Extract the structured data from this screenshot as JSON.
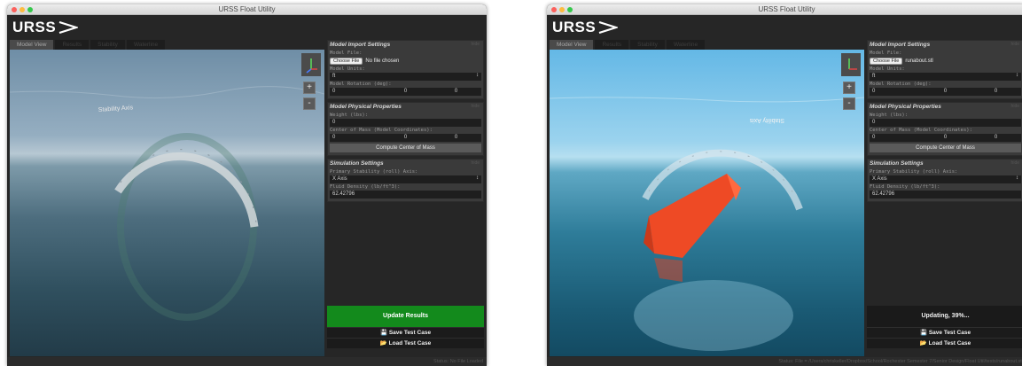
{
  "windows": [
    {
      "title": "URSS Float Utility",
      "logo": "URSS",
      "tabs": [
        "Model View",
        "Results",
        "Stability",
        "Waterline"
      ],
      "viewport": {
        "axis_label": "Stability Axis",
        "zoom_in": "+",
        "zoom_out": "-"
      },
      "import": {
        "title": "Model Import Settings",
        "hide": "hide",
        "file_label": "Model File:",
        "choose": "Choose File",
        "file_name": "No file chosen",
        "units_label": "Model Units:",
        "units": "ft",
        "rotation_label": "Model Rotation (deg):",
        "rotation": [
          "0",
          "0",
          "0"
        ]
      },
      "physical": {
        "title": "Model Physical Properties",
        "hide": "hide",
        "weight_label": "Weight (lbs):",
        "weight": "0",
        "com_label": "Center of Mass (Model Coordinates):",
        "com": [
          "0",
          "0",
          "0"
        ],
        "compute": "Compute Center of Mass"
      },
      "sim": {
        "title": "Simulation Settings",
        "hide": "hide",
        "axis_label": "Primary Stability (roll) Axis:",
        "axis": "X Axis",
        "density_label": "Fluid Density (lb/ft^3):",
        "density": "62.42796"
      },
      "update": "Update Results",
      "save": "Save Test Case",
      "load": "Load Test Case",
      "status": "Status: No File Loaded"
    },
    {
      "title": "URSS Float Utility",
      "logo": "URSS",
      "tabs": [
        "Model View",
        "Results",
        "Stability",
        "Waterline"
      ],
      "viewport": {
        "axis_label": "Stability Axis",
        "zoom_in": "+",
        "zoom_out": "-"
      },
      "import": {
        "title": "Model Import Settings",
        "hide": "hide",
        "file_label": "Model File:",
        "choose": "Choose File",
        "file_name": "runabout.stl",
        "units_label": "Model Units:",
        "units": "ft",
        "rotation_label": "Model Rotation (deg):",
        "rotation": [
          "0",
          "0",
          "0"
        ]
      },
      "physical": {
        "title": "Model Physical Properties",
        "hide": "hide",
        "weight_label": "Weight (lbs):",
        "weight": "0",
        "com_label": "Center of Mass (Model Coordinates):",
        "com": [
          "0",
          "0",
          "0"
        ],
        "compute": "Compute Center of Mass"
      },
      "sim": {
        "title": "Simulation Settings",
        "hide": "hide",
        "axis_label": "Primary Stability (roll) Axis:",
        "axis": "X Axis",
        "density_label": "Fluid Density (lb/ft^3):",
        "density": "62.42796"
      },
      "update": "Updating, 39%...",
      "save": "Save Test Case",
      "load": "Load Test Case",
      "status": "Status: File = /Users/chriskeller/Dropbox/School/Rochester Semester 7/Senior Design/Float Util/tests/runabout.stl"
    }
  ],
  "icons": [
    "save-icon",
    "load-icon",
    "axis-gizmo-icon",
    "logo-arrow-icon"
  ],
  "colors": {
    "update_green": "#138a1c",
    "hull_orange": "#ee4a25",
    "panel_bg": "#3a3a3a"
  }
}
